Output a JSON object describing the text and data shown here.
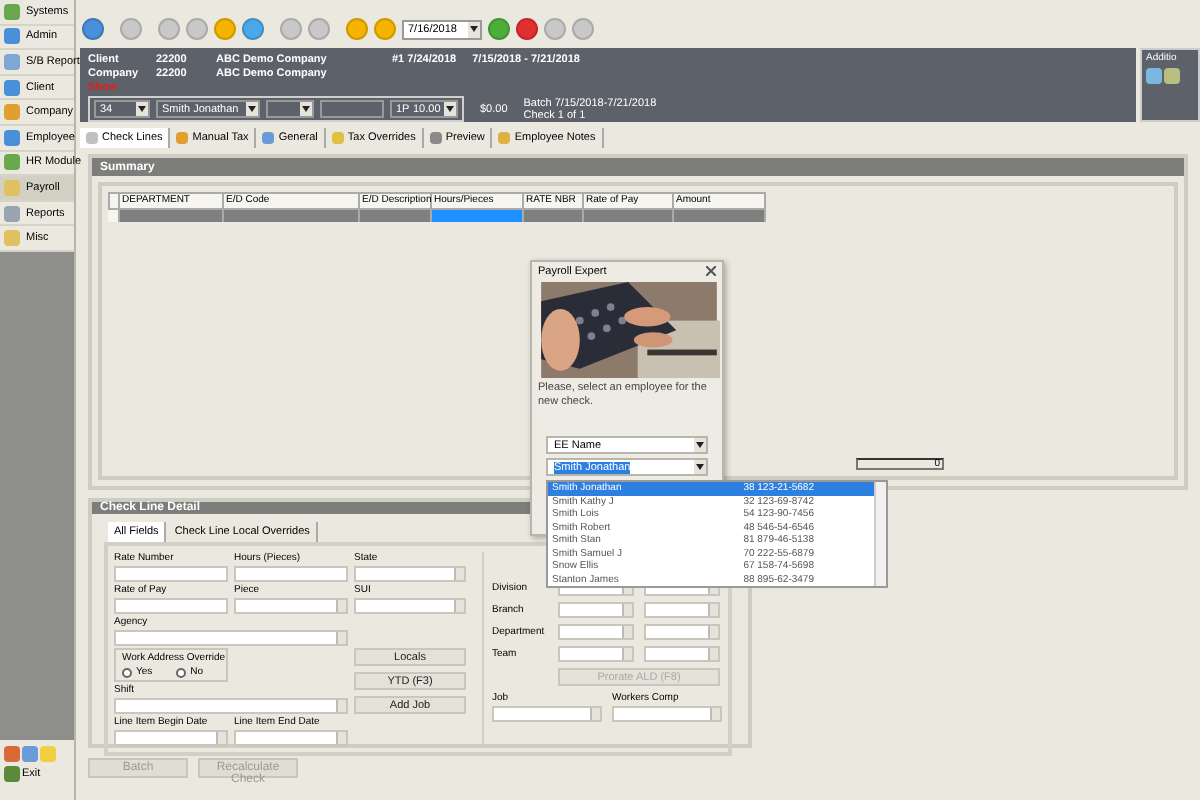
{
  "sidebar": {
    "items": [
      {
        "label": "Systems",
        "selected": false
      },
      {
        "label": "Admin",
        "selected": false
      },
      {
        "label": "S/B Report",
        "selected": false
      },
      {
        "label": "Client",
        "selected": false
      },
      {
        "label": "Company",
        "selected": false
      },
      {
        "label": "Employee",
        "selected": false
      },
      {
        "label": "HR Module",
        "selected": false
      },
      {
        "label": "Payroll",
        "selected": true
      },
      {
        "label": "Reports",
        "selected": false
      },
      {
        "label": "Misc",
        "selected": false
      }
    ],
    "exit": "Exit"
  },
  "toolbar": {
    "date": "7/16/2018"
  },
  "header": {
    "client_label": "Client",
    "client_number": "22200",
    "client_name": "ABC Demo Company",
    "check_number": "#1 7/24/2018",
    "period": "7/15/2018 - 7/21/2018",
    "company_label": "Company",
    "company_number": "22200",
    "company_name": "ABC Demo Company",
    "alert": "Show",
    "employee_number": "34",
    "employee_name": "Smith Jonathan",
    "pay_type": "1P",
    "pay_amount": "10.00",
    "total": "$0.00",
    "batch": "Batch 7/15/2018-7/21/2018",
    "check_count": "Check 1 of 1"
  },
  "additional": {
    "title": "Additio"
  },
  "tabs": [
    {
      "label": "Check Lines",
      "selected": true
    },
    {
      "label": "Manual Tax",
      "selected": false
    },
    {
      "label": "General",
      "selected": false
    },
    {
      "label": "Tax Overrides",
      "selected": false
    },
    {
      "label": "Preview",
      "selected": false
    },
    {
      "label": "Employee Notes",
      "selected": false
    }
  ],
  "summary": {
    "title": "Summary",
    "columns": [
      "DEPARTMENT",
      "E/D Code",
      "E/D Description",
      "Hours/Pieces",
      "RATE NBR",
      "Rate of Pay",
      "Amount"
    ],
    "count": "0"
  },
  "detail": {
    "title": "Check Line Detail",
    "tabs": [
      {
        "label": "All Fields",
        "selected": true
      },
      {
        "label": "Check Line Local Overrides",
        "selected": false
      }
    ],
    "fields": [
      {
        "label": "Rate Number",
        "kind": "text"
      },
      {
        "label": "Hours (Pieces)",
        "kind": "text"
      },
      {
        "label": "State",
        "kind": "select"
      },
      {
        "label": "Rate of Pay",
        "kind": "text"
      },
      {
        "label": "Piece",
        "kind": "select"
      },
      {
        "label": "SUI",
        "kind": "select"
      }
    ],
    "wide_fields": [
      {
        "label": "Agency"
      },
      {
        "label": "Shift"
      }
    ],
    "dates": [
      {
        "label": "Line Item Begin Date"
      },
      {
        "label": "Line Item End Date"
      }
    ],
    "override": {
      "title": "Work Address Override",
      "options": [
        {
          "label": "Yes",
          "selected": false
        },
        {
          "label": "No",
          "selected": false
        }
      ]
    },
    "buttons": [
      "Locals",
      "YTD (F3)",
      "Add Job"
    ],
    "org": [
      {
        "label": "Division"
      },
      {
        "label": "Branch"
      },
      {
        "label": "Department"
      },
      {
        "label": "Team"
      }
    ],
    "prorate": {
      "label": "Prorate ALD (F8)",
      "disabled": true
    },
    "lower": [
      {
        "label": "Job"
      },
      {
        "label": "Workers Comp"
      }
    ]
  },
  "bottom_buttons": [
    {
      "label": "Batch",
      "disabled": true
    },
    {
      "label": "Recalculate Check",
      "disabled": true
    }
  ],
  "dialog": {
    "title": "Payroll Expert",
    "message": "Please, select an employee for the new check.",
    "search_by": "EE Name",
    "value": "Smith Jonathan",
    "rows": [
      {
        "name": "Smith Jonathan",
        "code": "38 123-21-5682",
        "selected": true
      },
      {
        "name": "Smith Kathy J",
        "code": "32 123-69-8742",
        "selected": false
      },
      {
        "name": "Smith Lois",
        "code": "54 123-90-7456",
        "selected": false
      },
      {
        "name": "Smith Robert",
        "code": "48 546-54-6546",
        "selected": false
      },
      {
        "name": "Smith Stan",
        "code": "81 879-46-5138",
        "selected": false
      },
      {
        "name": "Smith Samuel J",
        "code": "70 222-55-6879",
        "selected": false
      },
      {
        "name": "Snow Ellis",
        "code": "67 158-74-5698",
        "selected": false
      },
      {
        "name": "Stanton James",
        "code": "88 895-62-3479",
        "selected": false
      }
    ]
  }
}
